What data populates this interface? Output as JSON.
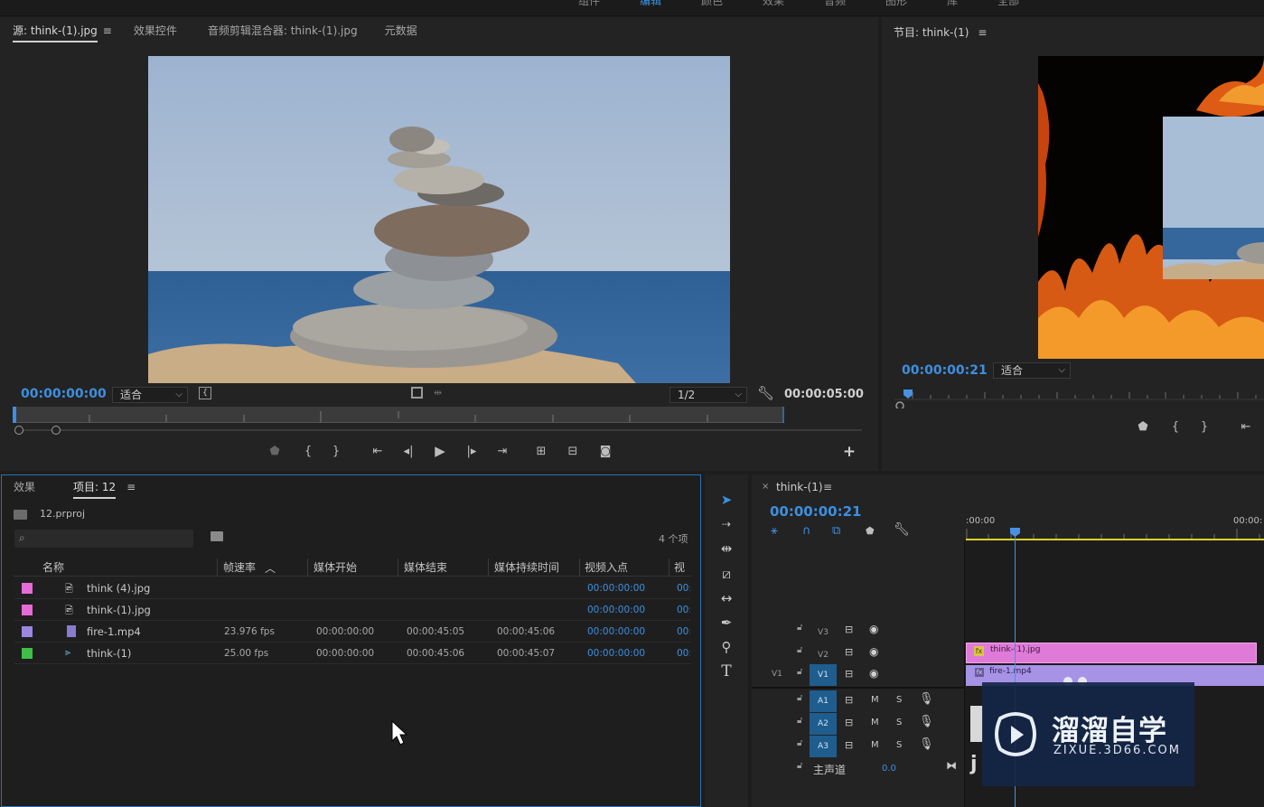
{
  "top_menu": {
    "items": [
      "组件",
      "编辑",
      "颜色",
      "效果",
      "音频",
      "图形",
      "库",
      "全部"
    ]
  },
  "source_panel": {
    "tabs": [
      {
        "label": "源: think-(1).jpg",
        "active": true
      },
      {
        "label": "效果控件",
        "active": false
      },
      {
        "label": "音频剪辑混合器: think-(1).jpg",
        "active": false
      },
      {
        "label": "元数据",
        "active": false
      }
    ],
    "timecode": "00:00:00:00",
    "fit_label": "适合",
    "resolution": "1/2",
    "duration": "00:00:05:00"
  },
  "program_panel": {
    "title": "节目: think-(1)",
    "timecode": "00:00:00:21",
    "fit_label": "适合"
  },
  "project_panel": {
    "tabs": [
      {
        "label": "效果",
        "active": false
      },
      {
        "label": "项目: 12",
        "active": true
      }
    ],
    "project_file": "12.prproj",
    "search_placeholder": "",
    "item_count": "4 个项",
    "columns": [
      "名称",
      "帧速率",
      "媒体开始",
      "媒体结束",
      "媒体持续时间",
      "视频入点",
      "视"
    ],
    "rows": [
      {
        "name": "think (4).jpg",
        "fps": "",
        "start": "",
        "end": "",
        "duration": "",
        "in": "00:00:00:00",
        "v": "00:",
        "color": "#e56bd6",
        "icon": "image"
      },
      {
        "name": "think-(1).jpg",
        "fps": "",
        "start": "",
        "end": "",
        "duration": "",
        "in": "00:00:00:00",
        "v": "00:",
        "color": "#e56bd6",
        "icon": "image"
      },
      {
        "name": "fire-1.mp4",
        "fps": "23.976 fps",
        "start": "00:00:00:00",
        "end": "00:00:45:05",
        "duration": "00:00:45:06",
        "in": "00:00:00:00",
        "v": "00:",
        "color": "#9b86e0",
        "icon": "film"
      },
      {
        "name": "think-(1)",
        "fps": "25.00 fps",
        "start": "00:00:00:00",
        "end": "00:00:45:06",
        "duration": "00:00:45:07",
        "in": "00:00:00:00",
        "v": "00:",
        "color": "#3fbf4a",
        "icon": "sequence"
      }
    ]
  },
  "timeline_panel": {
    "title": "think-(1)",
    "timecode": "00:00:00:21",
    "ruler_labels": [
      ":00:00",
      "00:00:"
    ],
    "video_tracks": [
      {
        "label": "V3",
        "src": ""
      },
      {
        "label": "V2",
        "src": ""
      },
      {
        "label": "V1",
        "src": "V1"
      }
    ],
    "audio_tracks": [
      {
        "label": "A1",
        "m": "M",
        "s": "S"
      },
      {
        "label": "A2",
        "m": "M",
        "s": "S"
      },
      {
        "label": "A3",
        "m": "M",
        "s": "S"
      }
    ],
    "master_label": "主声道",
    "master_value": "0.0",
    "clips": {
      "v2": "think-(1).jpg",
      "v1": "fire-1.mp4"
    }
  },
  "watermark": {
    "brand": "溜溜自学",
    "url": "ZIXUE.3D66.COM"
  },
  "colors": {
    "accent_blue": "#3d8fe0",
    "clip_pink": "#e07ad8",
    "clip_purple": "#a793e6",
    "track_blue": "#1f5d8e",
    "playhead": "#4a90e2"
  }
}
